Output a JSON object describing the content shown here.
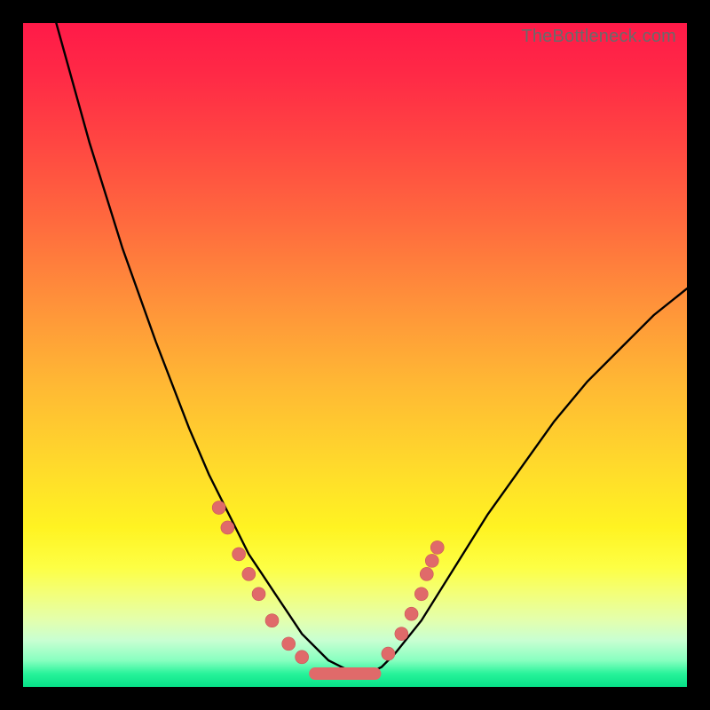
{
  "watermark": "TheBottleneck.com",
  "colors": {
    "background": "#000000",
    "curve": "#000000",
    "marker": "#e06a6a",
    "gradient_top": "#ff1a48",
    "gradient_bottom": "#06e188"
  },
  "chart_data": {
    "type": "line",
    "title": "",
    "xlabel": "",
    "ylabel": "",
    "xlim": [
      0,
      100
    ],
    "ylim": [
      0,
      100
    ],
    "note": "No numeric axes shown; values are relative positions (0–100) estimated from pixels.",
    "series": [
      {
        "name": "curve",
        "x": [
          5,
          10,
          15,
          20,
          25,
          28,
          30,
          32,
          34,
          36,
          38,
          40,
          42,
          44,
          46,
          48,
          50,
          52,
          54,
          56,
          60,
          65,
          70,
          75,
          80,
          85,
          90,
          95,
          100
        ],
        "y": [
          100,
          82,
          66,
          52,
          39,
          32,
          28,
          24,
          20,
          17,
          14,
          11,
          8,
          6,
          4,
          3,
          2,
          2,
          3,
          5,
          10,
          18,
          26,
          33,
          40,
          46,
          51,
          56,
          60
        ]
      }
    ],
    "markers_left": [
      {
        "x": 29.5,
        "y": 27
      },
      {
        "x": 30.8,
        "y": 24
      },
      {
        "x": 32.5,
        "y": 20
      },
      {
        "x": 34.0,
        "y": 17
      },
      {
        "x": 35.5,
        "y": 14
      },
      {
        "x": 37.5,
        "y": 10
      },
      {
        "x": 40.0,
        "y": 6.5
      },
      {
        "x": 42.0,
        "y": 4.5
      }
    ],
    "markers_right": [
      {
        "x": 55.0,
        "y": 5
      },
      {
        "x": 57.0,
        "y": 8
      },
      {
        "x": 58.5,
        "y": 11
      },
      {
        "x": 60.0,
        "y": 14
      },
      {
        "x": 60.8,
        "y": 17
      },
      {
        "x": 61.6,
        "y": 19
      },
      {
        "x": 62.4,
        "y": 21
      }
    ],
    "flat_segment": {
      "x0": 44,
      "x1": 53,
      "y": 2
    }
  }
}
